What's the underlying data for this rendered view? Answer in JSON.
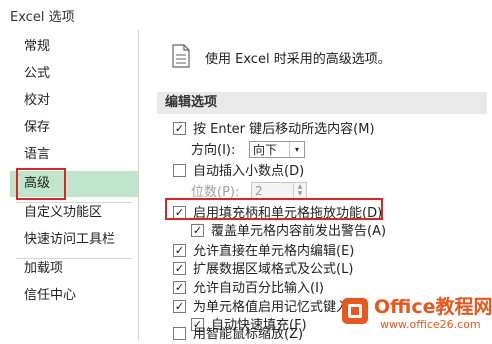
{
  "window": {
    "title": "Excel 选项"
  },
  "sidebar": {
    "items": [
      {
        "label": "常规"
      },
      {
        "label": "公式"
      },
      {
        "label": "校对"
      },
      {
        "label": "保存"
      },
      {
        "label": "语言"
      },
      {
        "label": "高级"
      },
      {
        "label": "自定义功能区"
      },
      {
        "label": "快速访问工具栏"
      },
      {
        "label": "加载项"
      },
      {
        "label": "信任中心"
      }
    ],
    "active": "高级"
  },
  "main": {
    "intro": "使用 Excel 时采用的高级选项。",
    "section": "编辑选项",
    "options": {
      "after_enter": {
        "label": "按 Enter 键后移动所选内容(M)",
        "checked": true
      },
      "direction_label": "方向(I):",
      "direction_value": "向下",
      "auto_decimal": {
        "label": "自动插入小数点(D)",
        "checked": false
      },
      "places_label": "位数(P):",
      "places_value": "2",
      "fill_handle": {
        "label": "启用填充柄和单元格拖放功能(D)",
        "checked": true
      },
      "overwrite_alert": {
        "label": "覆盖单元格内容前发出警告(A)",
        "checked": true
      },
      "edit_in_cell": {
        "label": "允许直接在单元格内编辑(E)",
        "checked": true
      },
      "extend_formats": {
        "label": "扩展数据区域格式及公式(L)",
        "checked": true
      },
      "auto_percent": {
        "label": "允许自动百分比输入(I)",
        "checked": true
      },
      "autocomplete": {
        "label": "为单元格值启用记忆式键入(A)",
        "checked": true
      },
      "flash_fill": {
        "label": "自动快速填充(F)",
        "checked": true
      },
      "intellimouse": {
        "label": "用智能鼠标缩放(Z)",
        "checked": false
      }
    }
  },
  "watermark": {
    "brand": "Office教程网",
    "url": "www.office26.com"
  },
  "colors": {
    "active_bg": "#bfe6cb",
    "highlight": "#d9262b",
    "brand": "#e8571e"
  },
  "icons": {
    "check": "✓",
    "dropdown": "▾"
  }
}
